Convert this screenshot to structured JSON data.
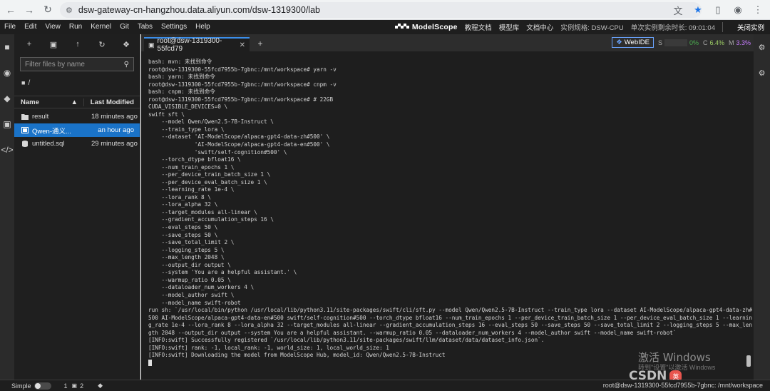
{
  "browser": {
    "url": "dsw-gateway-cn-hangzhou.data.aliyun.com/dsw-1319300/lab"
  },
  "menubar": {
    "items": [
      "File",
      "Edit",
      "View",
      "Run",
      "Kernel",
      "Git",
      "Tabs",
      "Settings",
      "Help"
    ],
    "brand": "ModelScope",
    "links": [
      "教程文档",
      "模型库",
      "文档中心"
    ],
    "instance_spec": "实例规格: DSW-CPU",
    "remaining_time": "单次实例剩余时长: 09:01:04",
    "close_instance": "关闭实例"
  },
  "filebrowser": {
    "filter_placeholder": "Filter files by name",
    "path": "/",
    "header_name": "Name",
    "header_modified": "Last Modified",
    "files": [
      {
        "name": "result",
        "modified": "18 minutes ago",
        "type": "folder"
      },
      {
        "name": "Qwen-通义...",
        "modified": "an hour ago",
        "type": "notebook"
      },
      {
        "name": "untitled.sql",
        "modified": "29 minutes ago",
        "type": "file"
      }
    ]
  },
  "tabs": {
    "active_tab": "root@dsw-1319300-55fcd79"
  },
  "status_widgets": {
    "webide": "WebIDE",
    "s_label": "S",
    "s_value": "0%",
    "c_label": "C",
    "c_value": "6.4%",
    "m_label": "M",
    "m_value": "3.3%"
  },
  "terminal": {
    "lines": [
      "bash: mvn: 未找到命令",
      "root@dsw-1319300-55fcd7955b-7gbnc:/mnt/workspace# yarn -v",
      "bash: yarn: 未找到命令",
      "root@dsw-1319300-55fcd7955b-7gbnc:/mnt/workspace# cnpm -v",
      "bash: cnpm: 未找到命令",
      "root@dsw-1319300-55fcd7955b-7gbnc:/mnt/workspace# # 22GB",
      "CUDA_VISIBLE_DEVICES=0 \\",
      "swift sft \\",
      "    --model Qwen/Qwen2.5-7B-Instruct \\",
      "    --train_type lora \\",
      "    --dataset 'AI-ModelScope/alpaca-gpt4-data-zh#500' \\",
      "              'AI-ModelScope/alpaca-gpt4-data-en#500' \\",
      "              'swift/self-cognition#500' \\",
      "    --torch_dtype bfloat16 \\",
      "    --num_train_epochs 1 \\",
      "    --per_device_train_batch_size 1 \\",
      "    --per_device_eval_batch_size 1 \\",
      "    --learning_rate 1e-4 \\",
      "    --lora_rank 8 \\",
      "    --lora_alpha 32 \\",
      "    --target_modules all-linear \\",
      "    --gradient_accumulation_steps 16 \\",
      "    --eval_steps 50 \\",
      "    --save_steps 50 \\",
      "    --save_total_limit 2 \\",
      "    --logging_steps 5 \\",
      "    --max_length 2048 \\",
      "    --output_dir output \\",
      "    --system 'You are a helpful assistant.' \\",
      "    --warmup_ratio 0.05 \\",
      "    --dataloader_num_workers 4 \\",
      "    --model_author swift \\",
      "    --model_name swift-robot",
      "run sh: `/usr/local/bin/python /usr/local/lib/python3.11/site-packages/swift/cli/sft.py --model Qwen/Qwen2.5-7B-Instruct --train_type lora --dataset AI-ModelScope/alpaca-gpt4-data-zh#",
      "500 AI-ModelScope/alpaca-gpt4-data-en#500 swift/self-cognition#500 --torch_dtype bfloat16 --num_train_epochs 1 --per_device_train_batch_size 1 --per_device_eval_batch_size 1 --learnin",
      "g_rate 1e-4 --lora_rank 8 --lora_alpha 32 --target_modules all-linear --gradient_accumulation_steps 16 --eval_steps 50 --save_steps 50 --save_total_limit 2 --logging_steps 5 --max_len",
      "gth 2048 --output_dir output --system You are a helpful assistant. --warmup_ratio 0.05 --dataloader_num_workers 4 --model_author swift --model_name swift-robot`",
      "[INFO:swift] Successfully registered `/usr/local/lib/python3.11/site-packages/swift/llm/dataset/data/dataset_info.json`.",
      "[INFO:swift] rank: -1, local_rank: -1, world_size: 1, local_world_size: 1",
      "[INFO:swift] Downloading the model from ModelScope Hub, model_id: Qwen/Qwen2.5-7B-Instruct"
    ]
  },
  "watermark": {
    "line1": "激活 Windows",
    "line2": "转到\"设置\"以激活 Windows",
    "csdn": "CSDN",
    "badge": "英"
  },
  "statusbar": {
    "mode": "Simple",
    "count1": "1",
    "count2": "2",
    "path": "root@dsw-1319300-55fcd7955b-7gbnc: /mnt/workspace"
  }
}
